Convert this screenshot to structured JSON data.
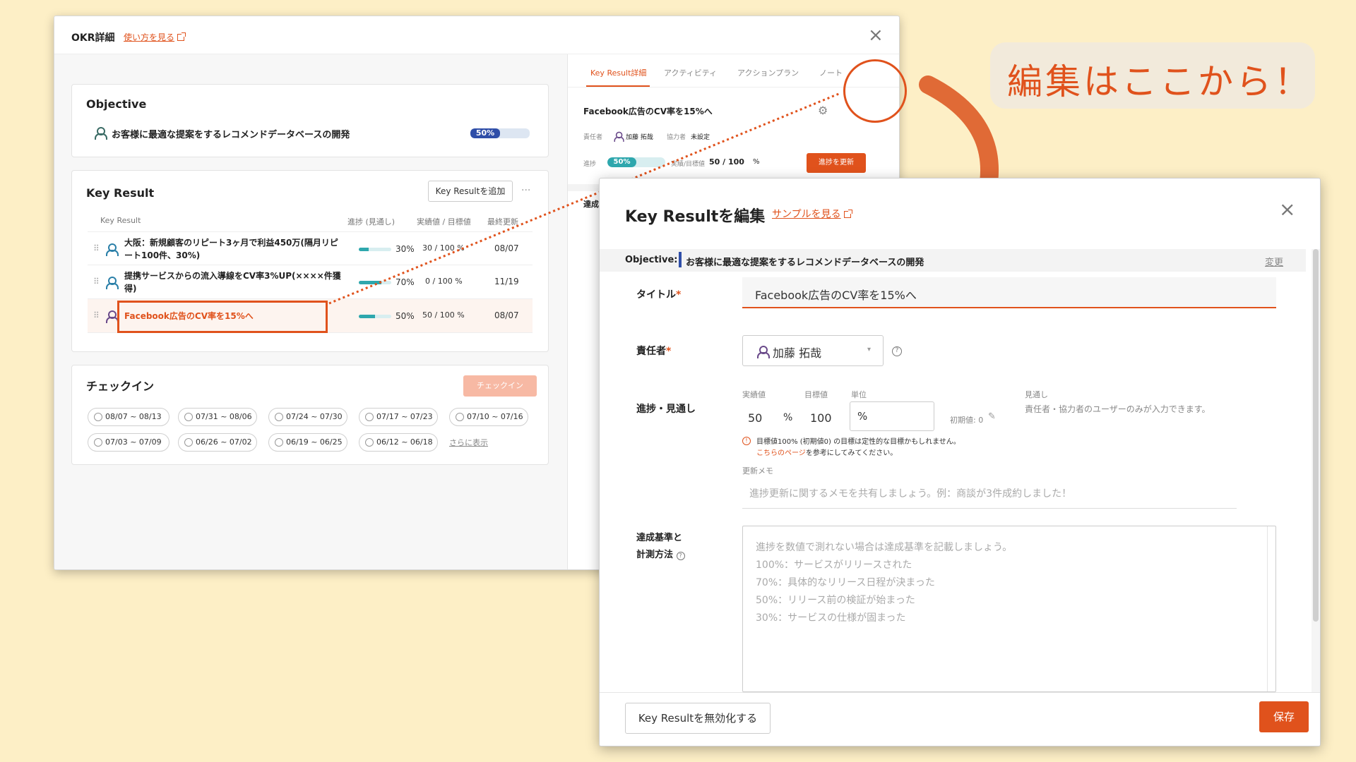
{
  "okr_window": {
    "title": "OKR詳細",
    "help_link": "使い方を見る",
    "objective": {
      "heading": "Objective",
      "text": "お客様に最適な提案をするレコメンドデータベースの開発",
      "progress": "50%",
      "progress_value": 0.5
    },
    "key_result": {
      "heading": "Key Result",
      "add_button": "Key Resultを追加",
      "more": "···",
      "columns": [
        "Key Result",
        "進捗 (見通し)",
        "実績値 / 目標値",
        "最終更新"
      ],
      "rows": [
        {
          "title": "大阪：新規顧客のリピート3ヶ月で利益450万(隔月リピート100件、30%)",
          "progress": "30%",
          "progress_value": 0.3,
          "value": "30 / 100 %",
          "updated": "08/07"
        },
        {
          "title": "提携サービスからの流入導線をCV率3%UP(××××件獲得)",
          "progress": "70%",
          "progress_value": 0.7,
          "value": "0 / 100 %",
          "updated": "11/19"
        },
        {
          "title": "Facebook広告のCV率を15%へ",
          "progress": "50%",
          "progress_value": 0.5,
          "value": "50 / 100 %",
          "updated": "08/07"
        }
      ]
    },
    "checkin": {
      "heading": "チェックイン",
      "button": "チェックイン",
      "periods": [
        "08/07 ~ 08/13",
        "07/31 ~ 08/06",
        "07/24 ~ 07/30",
        "07/17 ~ 07/23",
        "07/10 ~ 07/16",
        "07/03 ~ 07/09",
        "06/26 ~ 07/02",
        "06/19 ~ 06/25",
        "06/12 ~ 06/18"
      ],
      "more_link": "さらに表示"
    },
    "right_pane": {
      "tabs": [
        "Key Result詳細",
        "アクティビティ",
        "アクションプラン",
        "ノート"
      ],
      "kr_title": "Facebook広告のCV率を15%へ",
      "owner_label": "責任者",
      "owner": "加藤 拓哉",
      "collaborator_label": "協力者",
      "collaborator": "未設定",
      "progress_label": "進捗",
      "progress": "50%",
      "progress_value": 0.5,
      "value_label": "実績/目標値",
      "value": "50 / 100",
      "unit": "%",
      "update_button": "進捗を更新",
      "achievement_label": "達成"
    }
  },
  "edit_modal": {
    "title": "Key Resultを編集",
    "sample_link": "サンプルを見る",
    "objective_label": "Objective:",
    "objective_text": "お客様に最適な提案をするレコメンドデータベースの開発",
    "change_link": "変更",
    "title_label": "タイトル",
    "title_value": "Facebook広告のCV率を15%へ",
    "owner_label": "責任者",
    "owner_value": "加藤 拓哉",
    "progress_label": "進捗・見通し",
    "actual_label": "実績値",
    "actual_value": "50",
    "percent_sign": "%",
    "target_label": "目標値",
    "target_value": "100",
    "unit_label": "単位",
    "unit_value": "%",
    "initial_value": "初期値: 0",
    "outlook_label": "見通し",
    "outlook_note": "責任者・協力者のユーザーのみが入力できます。",
    "warning_line1": "目標値100% (初期値0) の目標は定性的な目標かもしれません。",
    "warning_link": "こちらのページ",
    "warning_line2_suffix": "を参考にしてみてください。",
    "memo_label": "更新メモ",
    "memo_placeholder": "進捗更新に関するメモを共有しましょう。例：商談が3件成約しました！",
    "criteria_label_1": "達成基準と",
    "criteria_label_2": "計測方法",
    "criteria_placeholder": [
      "進捗を数値で測れない場合は達成基準を記載しましょう。",
      "100%：サービスがリリースされた",
      "70%：具体的なリリース日程が決まった",
      "50%：リリース前の検証が始まった",
      "30%：サービスの仕様が固まった"
    ],
    "disable_button": "Key Resultを無効化する",
    "save_button": "保存"
  },
  "annotation": {
    "callout": "編集はここから！"
  },
  "colors": {
    "accent": "#e0521c",
    "progress_blue": "#2f4ea8",
    "progress_teal": "#2ea7ad",
    "background": "#fdefc6"
  }
}
